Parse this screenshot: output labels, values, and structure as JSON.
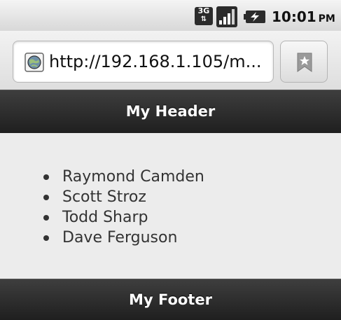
{
  "status_bar": {
    "network_label": "3G",
    "network_arrows": "⇅",
    "time": "10:01",
    "ampm": "PM",
    "icons": [
      "3g-icon",
      "signal-strength-icon",
      "battery-charging-icon"
    ]
  },
  "browser": {
    "url": "http://192.168.1.105/m...",
    "icons": [
      "globe-icon",
      "bookmark-icon"
    ]
  },
  "page": {
    "header_title": "My Header",
    "footer_title": "My Footer",
    "list_items": [
      "Raymond Camden",
      "Scott Stroz",
      "Todd Sharp",
      "Dave Ferguson"
    ]
  },
  "colors": {
    "toolbar_dark": "#2b2b2b",
    "content_background": "#ececec",
    "text_dark": "#333333"
  }
}
